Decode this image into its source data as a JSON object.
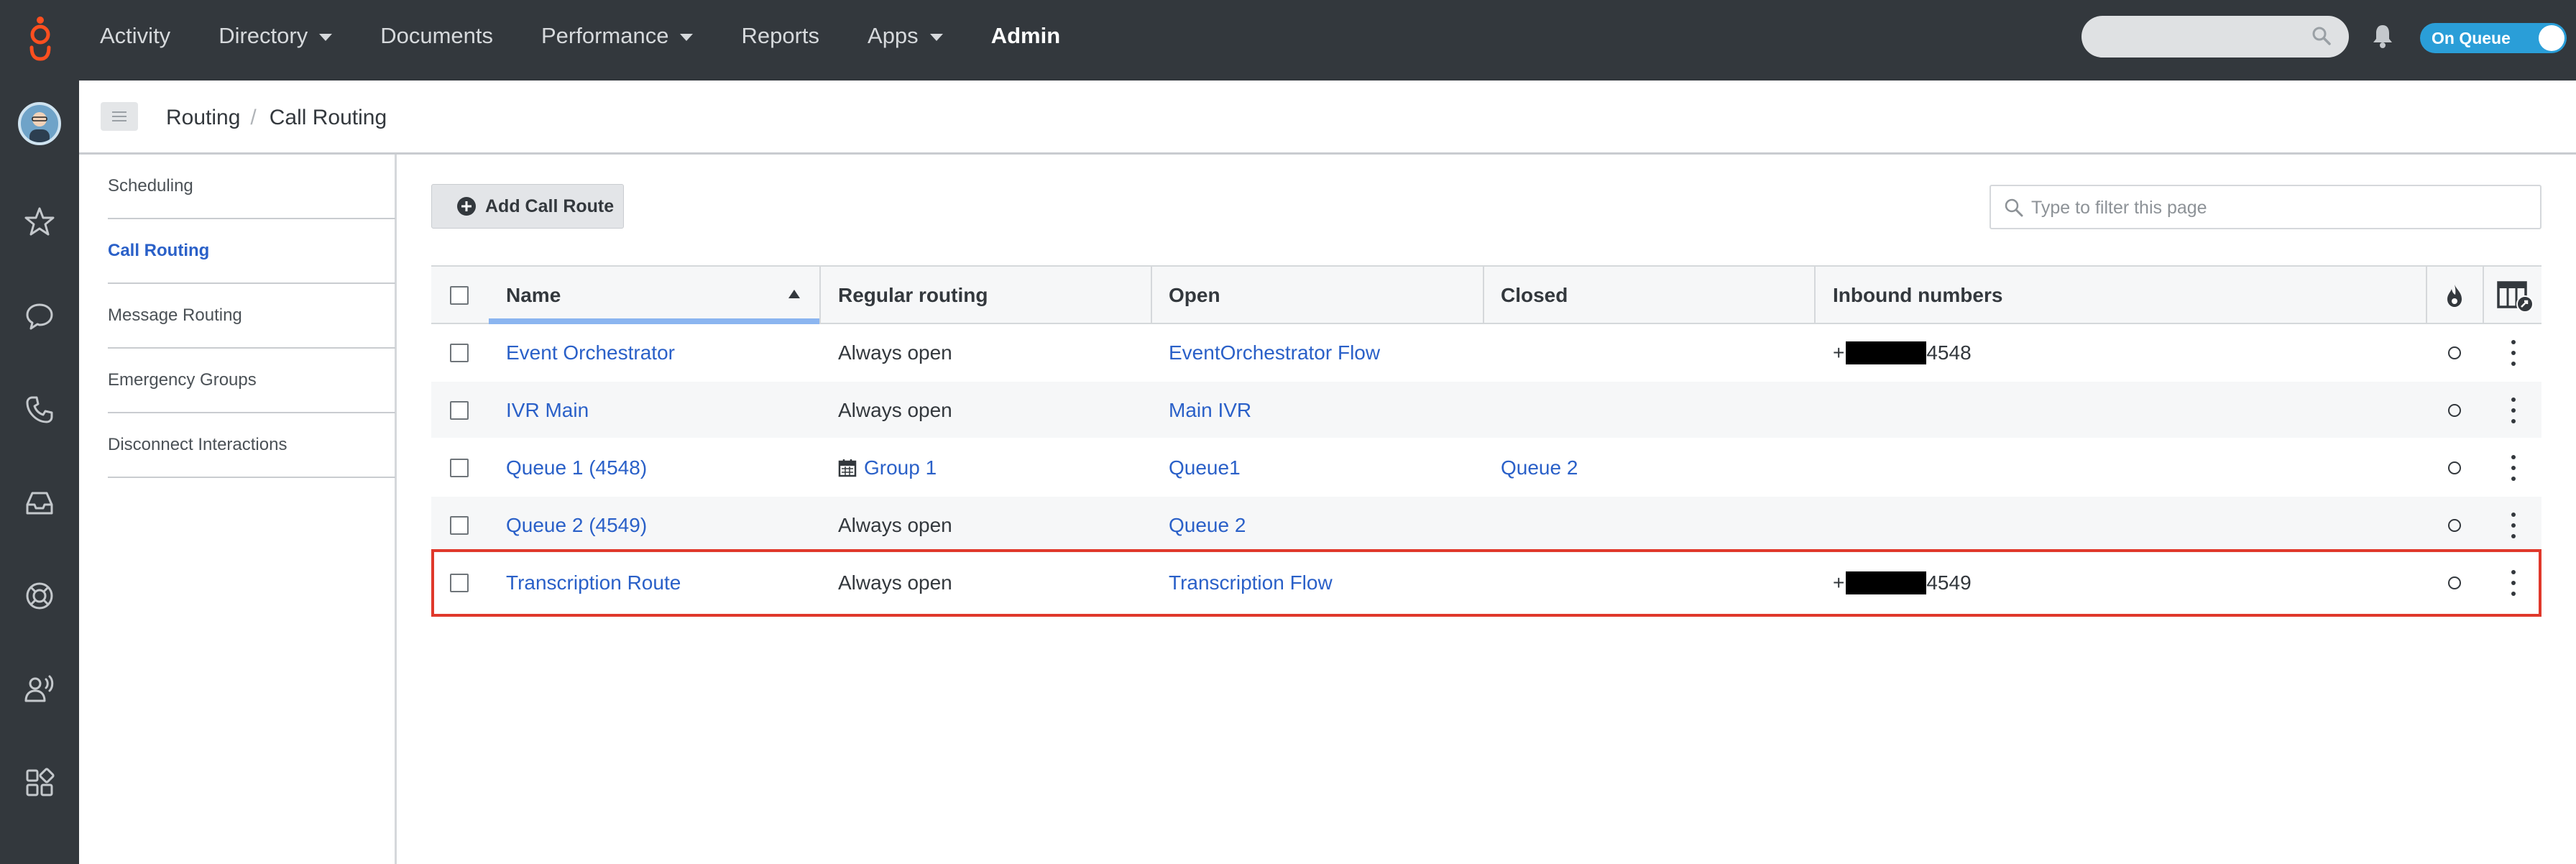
{
  "topbar": {
    "logo_icon": "genesys-logo-icon",
    "nav": [
      {
        "label": "Activity",
        "has_caret": false,
        "active": false
      },
      {
        "label": "Directory",
        "has_caret": true,
        "active": false
      },
      {
        "label": "Documents",
        "has_caret": false,
        "active": false
      },
      {
        "label": "Performance",
        "has_caret": true,
        "active": false
      },
      {
        "label": "Reports",
        "has_caret": false,
        "active": false
      },
      {
        "label": "Apps",
        "has_caret": true,
        "active": false
      },
      {
        "label": "Admin",
        "has_caret": false,
        "active": true
      }
    ],
    "search_value": "",
    "status_toggle": {
      "label": "On Queue",
      "on": true
    }
  },
  "rail": {
    "icons": [
      "avatar",
      "star-icon",
      "chat-bubble-icon",
      "phone-icon",
      "inbox-icon",
      "lifebuoy-icon",
      "agent-speaking-icon",
      "apps-grid-icon"
    ]
  },
  "breadcrumb": {
    "items": [
      "Routing",
      "Call Routing"
    ]
  },
  "sidemenu": {
    "items": [
      {
        "label": "Scheduling",
        "active": false
      },
      {
        "label": "Call Routing",
        "active": true
      },
      {
        "label": "Message Routing",
        "active": false
      },
      {
        "label": "Emergency Groups",
        "active": false
      },
      {
        "label": "Disconnect Interactions",
        "active": false
      }
    ]
  },
  "toolbar": {
    "add_label": "Add Call Route",
    "filter_placeholder": "Type to filter this page"
  },
  "table": {
    "headers": {
      "name": "Name",
      "regular_routing": "Regular routing",
      "open": "Open",
      "closed": "Closed",
      "inbound": "Inbound numbers"
    },
    "sort": {
      "column": "Name",
      "direction": "ascending"
    },
    "rows": [
      {
        "name": "Event Orchestrator",
        "regular": "Always open",
        "regular_schedule_icon": false,
        "open": "EventOrchestrator Flow",
        "closed": "",
        "inbound_prefix": "+",
        "inbound_suffix": "4548",
        "redacted": true,
        "highlighted": false
      },
      {
        "name": "IVR Main",
        "regular": "Always open",
        "regular_schedule_icon": false,
        "open": "Main IVR",
        "closed": "",
        "inbound_prefix": "",
        "inbound_suffix": "",
        "redacted": false,
        "highlighted": false
      },
      {
        "name": "Queue 1 (4548)",
        "regular": "Group 1",
        "regular_schedule_icon": true,
        "open": "Queue1",
        "closed": "Queue 2",
        "inbound_prefix": "",
        "inbound_suffix": "",
        "redacted": false,
        "highlighted": false
      },
      {
        "name": "Queue 2 (4549)",
        "regular": "Always open",
        "regular_schedule_icon": false,
        "open": "Queue 2",
        "closed": "",
        "inbound_prefix": "",
        "inbound_suffix": "",
        "redacted": false,
        "highlighted": false
      },
      {
        "name": "Transcription Route",
        "regular": "Always open",
        "regular_schedule_icon": false,
        "open": "Transcription Flow",
        "closed": "",
        "inbound_prefix": "+",
        "inbound_suffix": "4549",
        "redacted": true,
        "highlighted": true
      }
    ]
  },
  "colors": {
    "topbar_bg": "#33383d",
    "link": "#2a60c8",
    "highlight_border": "#e0382b",
    "toggle_on": "#2a9ed8",
    "logo": "#ff4f1f"
  }
}
